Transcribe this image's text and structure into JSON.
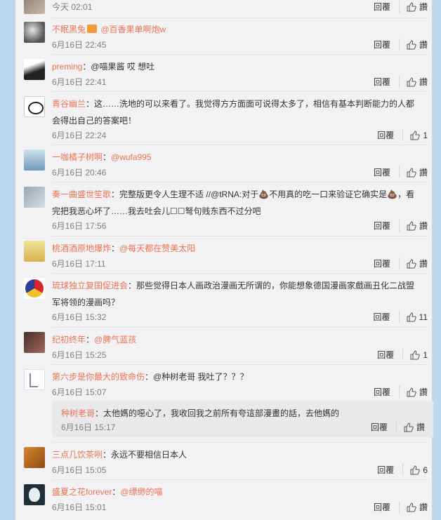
{
  "reply_label": "回覆",
  "like_label": "讚",
  "comments": [
    {
      "user": "",
      "sep": "",
      "text": "",
      "time": "今天 02:01",
      "likes": "讚"
    },
    {
      "user": "不眠黑兔",
      "sep": " ",
      "text": "@百香果单啊炮w",
      "time": "6月16日 22:45",
      "likes": "讚"
    },
    {
      "user": "preming",
      "sep": "：",
      "text": "@喵果酱 哎 想吐",
      "time": "6月16日 22:41",
      "likes": "讚"
    },
    {
      "user": "青谷幽兰",
      "sep": "：",
      "text": "这……洗地的可以来看了。我觉得方方面面可说得太多了，相信有基本判断能力的人都会得出自己的答案吧！",
      "time": "6月16日 22:24",
      "likes": "1"
    },
    {
      "user": "一咖橘子树啊",
      "sep": "：",
      "text": "@wufa995",
      "time": "6月16日 20:46",
      "likes": "讚"
    },
    {
      "user": "奏一曲盛世笙歌",
      "sep": "：",
      "text": "完整版更令人生理不适 //@tRNA:对于💩不用真的吃一口来验证它确实是💩，看完把我恶心坏了……我去吐会儿☐☐弩句贱东西不过分吧",
      "time": "6月16日 17:56",
      "likes": "讚"
    },
    {
      "user": "桃酒酒原地爆炸",
      "sep": "：",
      "text": "@每天都在赞美太阳",
      "time": "6月16日 17:11",
      "likes": "讚"
    },
    {
      "user": "琉球独立复国促进会",
      "sep": "：",
      "text": "那些觉得日本人画政治漫画无所谓的，你能想象德国漫画家戲画丑化二战盟军将领的漫画吗？",
      "time": "6月16日 15:32",
      "likes": "11"
    },
    {
      "user": "纪初终年",
      "sep": "：",
      "text": "@脾气蓝孩",
      "time": "6月16日 15:25",
      "likes": "1"
    },
    {
      "user": "第六步是你最大的致命伤",
      "sep": "：",
      "text": "@种树老哥 我吐了？？？",
      "time": "6月16日 15:07",
      "likes": "讚"
    },
    {
      "user": "三点几饮茶咧",
      "sep": "：",
      "text": "永远不要相信日本人",
      "time": "6月16日 15:05",
      "likes": "6"
    },
    {
      "user": "盛夏之花forever",
      "sep": "：",
      "text": "@缥缈的喵",
      "time": "6月16日 15:01",
      "likes": "讚"
    }
  ],
  "sub_reply": {
    "user": "种树老哥",
    "sep": "：",
    "text": "太他媽的噁心了，我收回我之前所有夸這部漫畫的話，去他媽的",
    "time": "6月16日 15:17",
    "likes": "讚"
  }
}
